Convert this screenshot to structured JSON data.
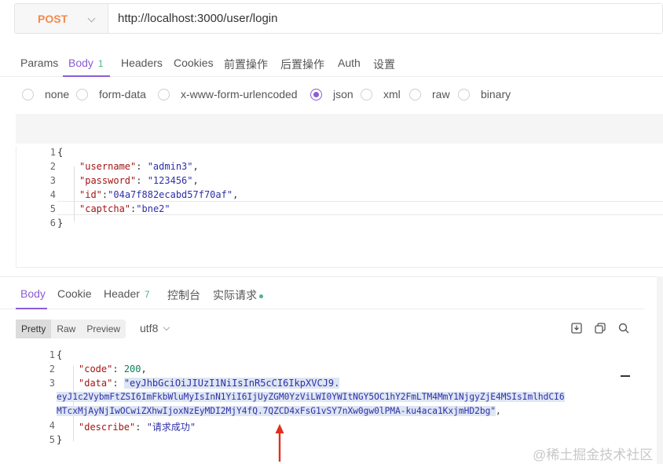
{
  "request": {
    "method": "POST",
    "url": "http://localhost:3000/user/login"
  },
  "request_tabs": [
    {
      "label": "Params"
    },
    {
      "label": "Body",
      "badge": "1"
    },
    {
      "label": "Headers"
    },
    {
      "label": "Cookies"
    },
    {
      "label": "前置操作"
    },
    {
      "label": "后置操作"
    },
    {
      "label": "Auth"
    },
    {
      "label": "设置"
    }
  ],
  "body_types": [
    "none",
    "form-data",
    "x-www-form-urlencoded",
    "json",
    "xml",
    "raw",
    "binary"
  ],
  "body_type_selected": "json",
  "request_body": {
    "line_numbers": [
      "1",
      "2",
      "3",
      "4",
      "5",
      "6"
    ],
    "username_key": "\"username\"",
    "username_val": "\"admin3\"",
    "password_key": "\"password\"",
    "password_val": "\"123456\"",
    "id_key": "\"id\"",
    "id_val": "\"04a7f882ecabd57f70af\"",
    "captcha_key": "\"captcha\"",
    "captcha_val": "\"bne2\""
  },
  "response_tabs": [
    {
      "label": "Body"
    },
    {
      "label": "Cookie"
    },
    {
      "label": "Header",
      "badge": "7"
    },
    {
      "label": "控制台"
    },
    {
      "label": "实际请求"
    }
  ],
  "view_modes": [
    "Pretty",
    "Raw",
    "Preview"
  ],
  "encoding": "utf8",
  "response_body": {
    "line_numbers": [
      "1",
      "2",
      "3",
      "",
      "4",
      "5"
    ],
    "code_key": "\"code\"",
    "code_val": "200",
    "data_key": "\"data\"",
    "data_line1": "\"eyJhbGciOiJIUzI1NiIsInR5cCI6IkpXVCJ9.",
    "data_line2": "eyJ1c2VybmFtZSI6ImFkbWluMyIsInN1YiI6IjUyZGM0YzViLWI0YWItNGY5OC1hY2FmLTM4MmY1NjgyZjE4MSIsImlhdCI6",
    "data_line3": "MTcxMjAyNjIwOCwiZXhwIjoxNzEyMDI2MjY4fQ.7QZCD4xFsG1vSY7nXw0gw0lPMA-ku4aca1KxjmHD2bg\"",
    "describe_key": "\"describe\"",
    "describe_val": "\"请求成功\""
  },
  "watermark": "@稀土掘金技术社区",
  "colors": {
    "accent": "#8c5cd6",
    "method": "#f5894d",
    "badge": "#4fb38b",
    "arrow": "#e0301e"
  }
}
